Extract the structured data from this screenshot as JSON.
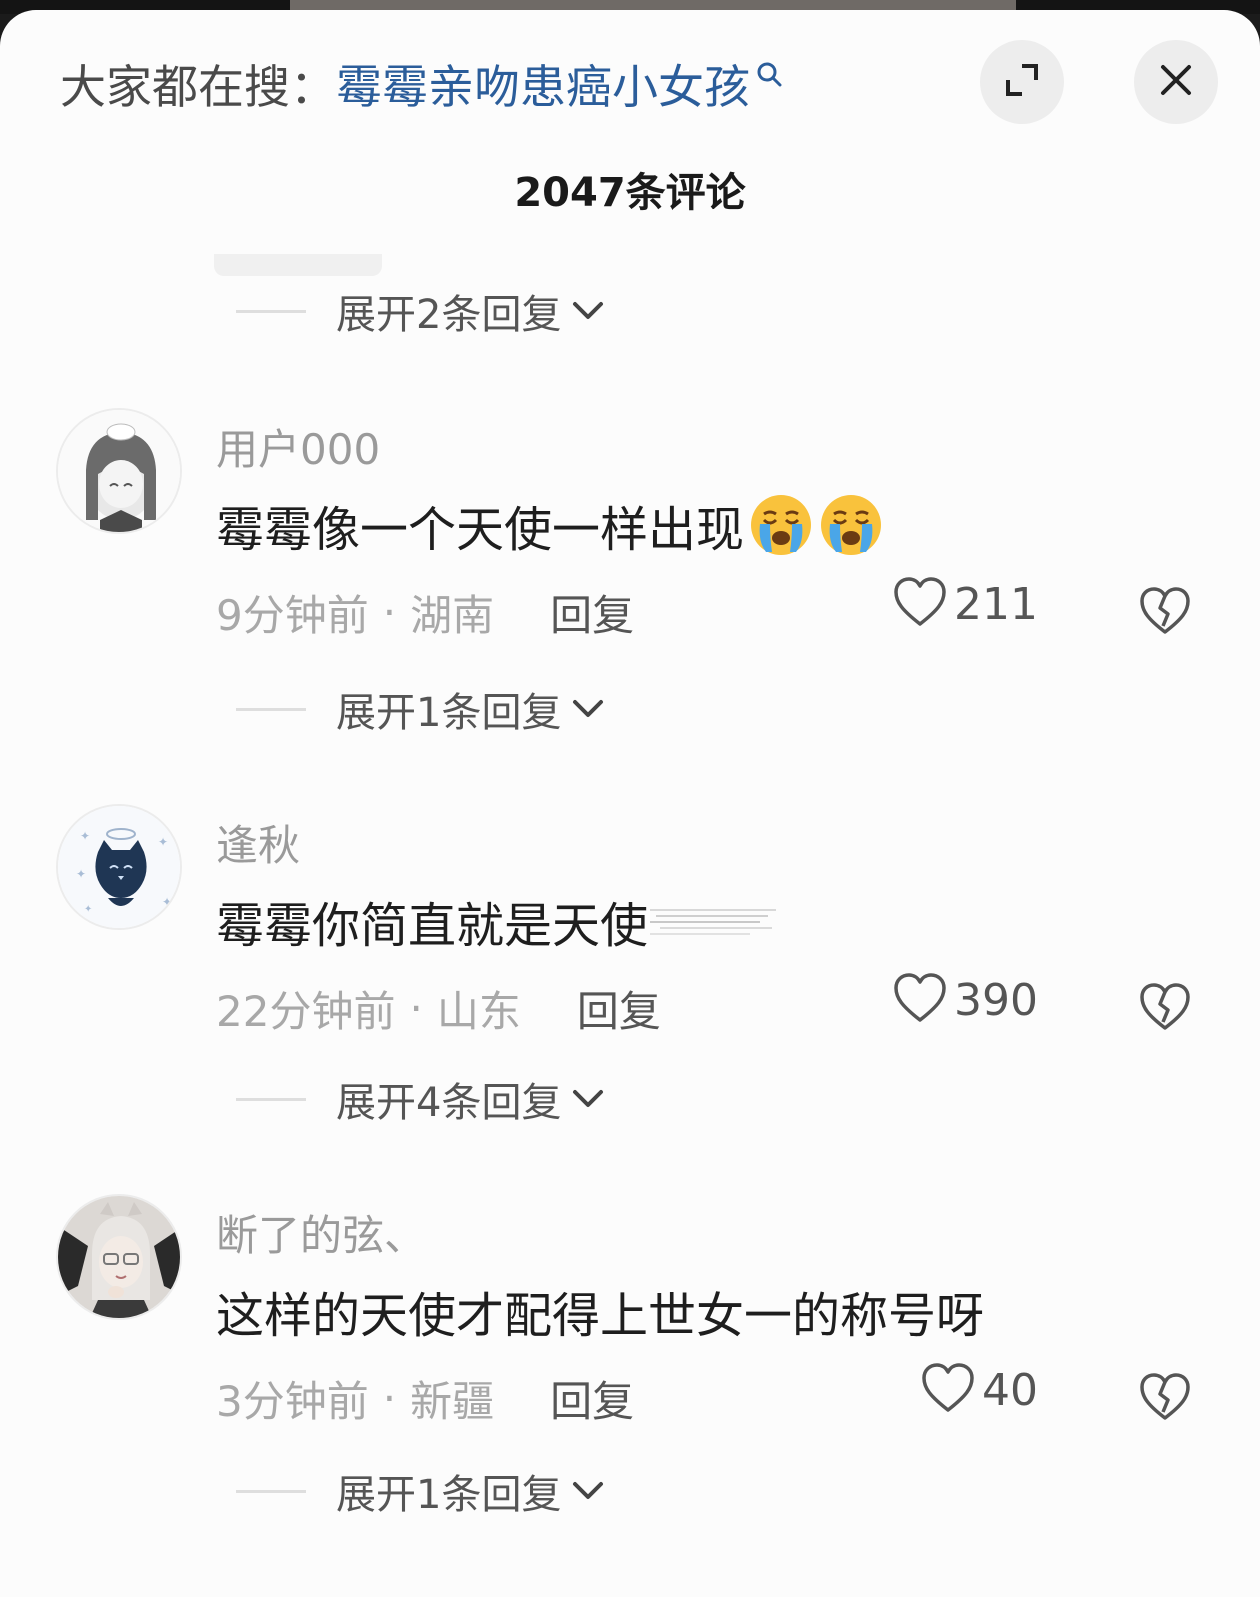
{
  "header": {
    "search_prefix": "大家都在搜：",
    "search_term": "霉霉亲吻患癌小女孩",
    "comment_count": "2047条评论"
  },
  "expand_labels": [
    "展开2条回复",
    "展开1条回复",
    "展开4条回复",
    "展开1条回复"
  ],
  "comments": [
    {
      "username": "用户000",
      "text": "霉霉像一个天使一样出现",
      "emojis": [
        "loudly-crying-face",
        "loudly-crying-face"
      ],
      "time": "9分钟前",
      "location": "湖南",
      "reply_label": "回复",
      "likes": "211"
    },
    {
      "username": "逢秋",
      "text": "霉霉你简直就是天使",
      "time": "22分钟前",
      "location": "山东",
      "reply_label": "回复",
      "likes": "390"
    },
    {
      "username": "断了的弦、",
      "text": "这样的天使才配得上世女一的称号呀",
      "time": "3分钟前",
      "location": "新疆",
      "reply_label": "回复",
      "likes": "40"
    }
  ],
  "icons": {
    "search": "search-icon",
    "expand": "fullscreen-icon",
    "close": "close-icon",
    "chevron": "chevron-down-icon",
    "like": "heart-outline-icon",
    "dislike": "broken-heart-icon"
  },
  "colors": {
    "search_term": "#2b5d9a",
    "sheet_background": "#fcfcfc",
    "muted_text": "#9a9a9a"
  }
}
